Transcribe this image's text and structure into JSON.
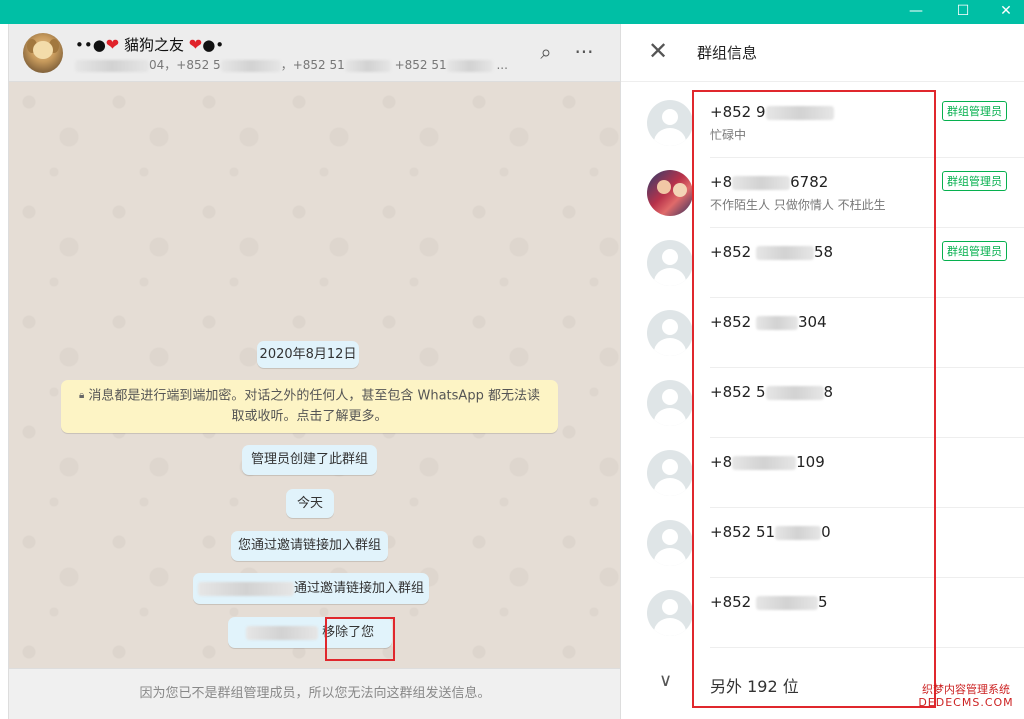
{
  "window": {
    "minimize_glyph": "—",
    "maximize_glyph": "☐",
    "close_glyph": "✕"
  },
  "chat": {
    "title_prefix": "••●",
    "title_name": "貓狗之友",
    "title_suffix": "●•",
    "members_parts": [
      "04，+852 5",
      "，+852 51",
      "+852 51",
      "..."
    ],
    "search_icon": "⌕",
    "menu_icon": "···",
    "date_bubble": "2020年8月12日",
    "encryption_notice": "消息都是进行端到端加密。对话之外的任何人，甚至包含 WhatsApp 都无法读取或收听。点击了解更多。",
    "msg_created": "管理员创建了此群组",
    "today_bubble": "今天",
    "msg_joined_self": "您通过邀请链接加入群组",
    "msg_joined_other": "通过邀请链接加入群组",
    "msg_removed": "移除了您",
    "footer_text": "因为您已不是群组管理成员，所以您无法向这群组发送信息。"
  },
  "info": {
    "close_icon": "✕",
    "title": "群组信息",
    "admin_label": "群组管理员",
    "members": [
      {
        "name_a": "+852 9",
        "name_b": "",
        "status": "忙碌中",
        "admin": true,
        "avatar": "default"
      },
      {
        "name_a": "+8",
        "name_b": "6782",
        "status": "不作陌生人 只做你情人 不枉此生",
        "admin": true,
        "avatar": "photo"
      },
      {
        "name_a": "+852",
        "name_b": "58",
        "status": "",
        "admin": true,
        "avatar": "default"
      },
      {
        "name_a": "+852",
        "name_b": "304",
        "status": "",
        "admin": false,
        "avatar": "default"
      },
      {
        "name_a": "+852 5",
        "name_b": "8",
        "status": "",
        "admin": false,
        "avatar": "default"
      },
      {
        "name_a": "+8",
        "name_b": "109",
        "status": "",
        "admin": false,
        "avatar": "default"
      },
      {
        "name_a": "+852 51",
        "name_b": "0",
        "status": "",
        "admin": false,
        "avatar": "default"
      },
      {
        "name_a": "+852",
        "name_b": "5",
        "status": "",
        "admin": false,
        "avatar": "default"
      }
    ],
    "more_icon": "∨",
    "more_text": "另外 192 位"
  },
  "watermark": {
    "line1": "织梦内容管理系统",
    "line2": "DEDECMS.COM"
  },
  "colors": {
    "titlebar": "#00bfa5",
    "highlight_red": "#e0272d",
    "admin_green": "#06b04e"
  }
}
